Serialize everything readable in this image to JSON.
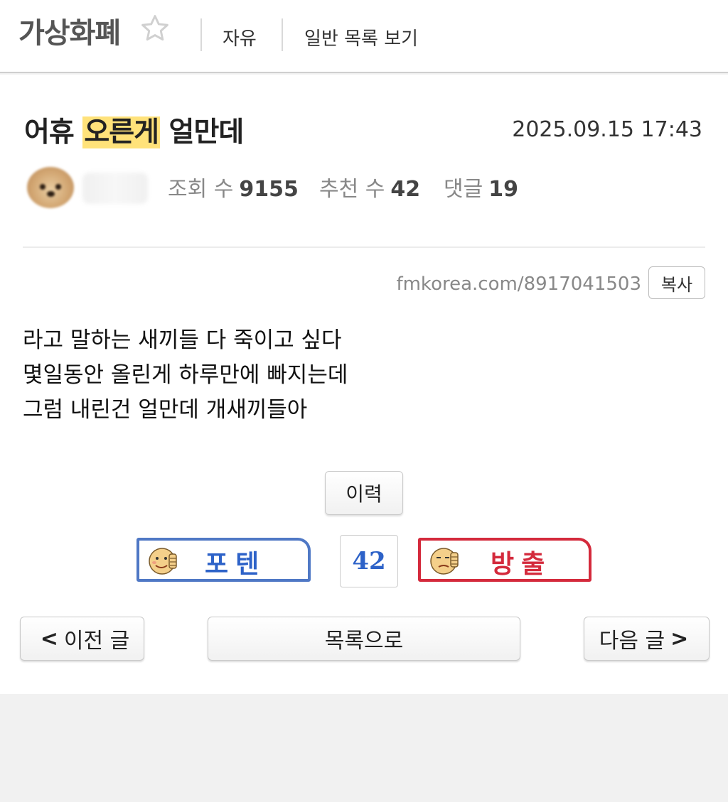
{
  "header": {
    "board_title": "가상화폐",
    "favorite_icon": "star-outline-icon",
    "category_link": "자유",
    "list_link": "일반 목록 보기"
  },
  "post": {
    "title_before": "어휴 ",
    "title_highlight": "오른게",
    "title_after": " 얼만데",
    "highlight_color": "#ffe27a",
    "date": "2025.09.15 17:43",
    "author_avatar_icon": "puppy-avatar-icon",
    "views_label": "조회 수",
    "views": "9155",
    "recommend_label": "추천 수",
    "recommend": "42",
    "comments_label": "댓글",
    "comments": "19",
    "url": "fmkorea.com/8917041503",
    "copy_label": "복사",
    "body_lines": [
      "라고 말하는 새끼들 다 죽이고 싶다",
      "몇일동안 올린게 하루만에 빠지는데",
      "그럼 내린건 얼만데 개새끼들아"
    ]
  },
  "actions": {
    "history_label": "이력",
    "vote_up_label": "포텐",
    "vote_up_color": "#2d62c8",
    "vote_count": "42",
    "vote_down_label": "방출",
    "vote_down_color": "#d42a3c"
  },
  "navigation": {
    "prev_arrow": "<",
    "prev_label": "이전 글",
    "list_label": "목록으로",
    "next_label": "다음 글",
    "next_arrow": ">"
  }
}
